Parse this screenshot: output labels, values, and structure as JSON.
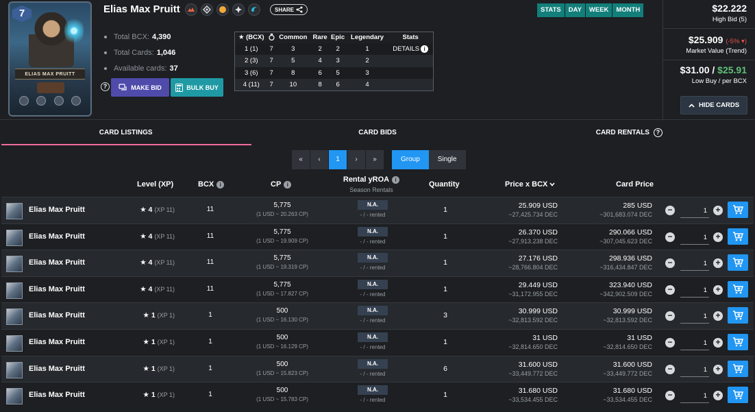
{
  "card": {
    "name": "Elias Max Pruitt",
    "art_level": "7",
    "art_name": "ELIAS MAX PRUITT",
    "badges": [
      "fire-element-icon",
      "edition-icon",
      "gold-foil-icon",
      "rarity-icon",
      "water-element-icon"
    ],
    "share_label": "SHARE"
  },
  "summary": [
    {
      "label": "Total BCX:",
      "value": "4,390"
    },
    {
      "label": "Total Cards:",
      "value": "1,046"
    },
    {
      "label": "Available cards:",
      "value": "37"
    }
  ],
  "actions": {
    "make_bid": "MAKE BID",
    "bulk_buy": "BULK BUY",
    "help": "?"
  },
  "level_table": {
    "headers": [
      "(BCX)",
      "",
      "Common",
      "Rare",
      "Epic",
      "Legendary",
      "Stats"
    ],
    "rows": [
      [
        "1 (1)",
        "7",
        "3",
        "2",
        "2",
        "1",
        "DETAILS"
      ],
      [
        "2 (3)",
        "7",
        "5",
        "4",
        "3",
        "2",
        ""
      ],
      [
        "3 (6)",
        "7",
        "8",
        "6",
        "5",
        "3",
        ""
      ],
      [
        "4 (11)",
        "7",
        "10",
        "8",
        "6",
        "4",
        ""
      ]
    ]
  },
  "periods": [
    "STATS",
    "DAY",
    "WEEK",
    "MONTH"
  ],
  "prices": {
    "high_bid": "$22.222",
    "high_bid_label": "High Bid (5)",
    "market_value": "$25.909",
    "market_change": "(-5%",
    "market_label": "Market Value (Trend)",
    "low_buy": "$31.00 /",
    "per_bcx": "$25.91",
    "low_label": "Low Buy / per BCX",
    "hide_cards": "HIDE CARDS"
  },
  "tabs": [
    {
      "label": "CARD LISTINGS"
    },
    {
      "label": "CARD BIDS"
    },
    {
      "label": "CARD RENTALS"
    }
  ],
  "pager": {
    "first": "«",
    "prev": "‹",
    "page": "1",
    "next": "›",
    "last": "»"
  },
  "grouping": {
    "group": "Group",
    "single": "Single"
  },
  "columns": {
    "level": "Level (XP)",
    "bcx": "BCX",
    "cp": "CP",
    "rental": "Rental yROA",
    "rental_sub": "Season Rentals",
    "quantity": "Quantity",
    "price_bcx": "Price x BCX",
    "card_price": "Card Price"
  },
  "listings": [
    {
      "name": "Elias Max Pruitt",
      "level": "4",
      "xp": "(XP 11)",
      "bcx": "11",
      "cp": "5,775",
      "cp_sub": "(1 USD ~ 20.263 CP)",
      "rental": "N.A.",
      "rented": "- / - rented",
      "qty": "1",
      "pbcx": "25.909 USD",
      "pbcx_dec": "~27,425.734 DEC",
      "cprice": "285 USD",
      "cprice_dec": "~301,683.074 DEC",
      "buy_qty": "1"
    },
    {
      "name": "Elias Max Pruitt",
      "level": "4",
      "xp": "(XP 11)",
      "bcx": "11",
      "cp": "5,775",
      "cp_sub": "(1 USD ~ 19.909 CP)",
      "rental": "N.A.",
      "rented": "- / - rented",
      "qty": "1",
      "pbcx": "26.370 USD",
      "pbcx_dec": "~27,913.238 DEC",
      "cprice": "290.066 USD",
      "cprice_dec": "~307,045.623 DEC",
      "buy_qty": "1"
    },
    {
      "name": "Elias Max Pruitt",
      "level": "4",
      "xp": "(XP 11)",
      "bcx": "11",
      "cp": "5,775",
      "cp_sub": "(1 USD ~ 19.319 CP)",
      "rental": "N.A.",
      "rented": "- / - rented",
      "qty": "1",
      "pbcx": "27.176 USD",
      "pbcx_dec": "~28,766.804 DEC",
      "cprice": "298.936 USD",
      "cprice_dec": "~316,434.847 DEC",
      "buy_qty": "1"
    },
    {
      "name": "Elias Max Pruitt",
      "level": "4",
      "xp": "(XP 11)",
      "bcx": "11",
      "cp": "5,775",
      "cp_sub": "(1 USD ~ 17.827 CP)",
      "rental": "N.A.",
      "rented": "- / - rented",
      "qty": "1",
      "pbcx": "29.449 USD",
      "pbcx_dec": "~31,172.955 DEC",
      "cprice": "323.940 USD",
      "cprice_dec": "~342,902.509 DEC",
      "buy_qty": "1"
    },
    {
      "name": "Elias Max Pruitt",
      "level": "1",
      "xp": "(XP 1)",
      "bcx": "1",
      "cp": "500",
      "cp_sub": "(1 USD ~ 16.130 CP)",
      "rental": "N.A.",
      "rented": "- / - rented",
      "qty": "3",
      "pbcx": "30.999 USD",
      "pbcx_dec": "~32,813.592 DEC",
      "cprice": "30.999 USD",
      "cprice_dec": "~32,813.592 DEC",
      "buy_qty": "1"
    },
    {
      "name": "Elias Max Pruitt",
      "level": "1",
      "xp": "(XP 1)",
      "bcx": "1",
      "cp": "500",
      "cp_sub": "(1 USD ~ 16.129 CP)",
      "rental": "N.A.",
      "rented": "- / - rented",
      "qty": "1",
      "pbcx": "31 USD",
      "pbcx_dec": "~32,814.650 DEC",
      "cprice": "31 USD",
      "cprice_dec": "~32,814.650 DEC",
      "buy_qty": "1"
    },
    {
      "name": "Elias Max Pruitt",
      "level": "1",
      "xp": "(XP 1)",
      "bcx": "1",
      "cp": "500",
      "cp_sub": "(1 USD ~ 15.823 CP)",
      "rental": "N.A.",
      "rented": "- / - rented",
      "qty": "6",
      "pbcx": "31.600 USD",
      "pbcx_dec": "~33,449.772 DEC",
      "cprice": "31.600 USD",
      "cprice_dec": "~33,449.772 DEC",
      "buy_qty": "1"
    },
    {
      "name": "Elias Max Pruitt",
      "level": "1",
      "xp": "(XP 1)",
      "bcx": "1",
      "cp": "500",
      "cp_sub": "(1 USD ~ 15.783 CP)",
      "rental": "N.A.",
      "rented": "- / - rented",
      "qty": "1",
      "pbcx": "31.680 USD",
      "pbcx_dec": "~33,534.455 DEC",
      "cprice": "31.680 USD",
      "cprice_dec": "~33,534.455 DEC",
      "buy_qty": "1"
    }
  ],
  "colors": {
    "accent": "#2196f3",
    "teal": "#127f7a",
    "bid": "#4f4bab",
    "bulk": "#1f9aa5",
    "tab_underline": "#f06c9b",
    "down": "#e55050",
    "per_bcx": "#5fc07a"
  }
}
